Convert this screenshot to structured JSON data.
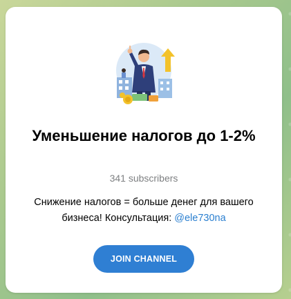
{
  "channel": {
    "title": "Уменьшение налогов до 1-2%",
    "subscribers": "341 subscribers",
    "description_text": "Снижение налогов = больше денег для вашего бизнеса! Консультация: ",
    "mention": "@ele730na"
  },
  "actions": {
    "join_label": "JOIN CHANNEL"
  },
  "colors": {
    "accent": "#2f7fd3",
    "link": "#2a7fd0",
    "muted_text": "#7d7f81"
  },
  "avatar": {
    "icon": "businessman-illustration-icon"
  }
}
